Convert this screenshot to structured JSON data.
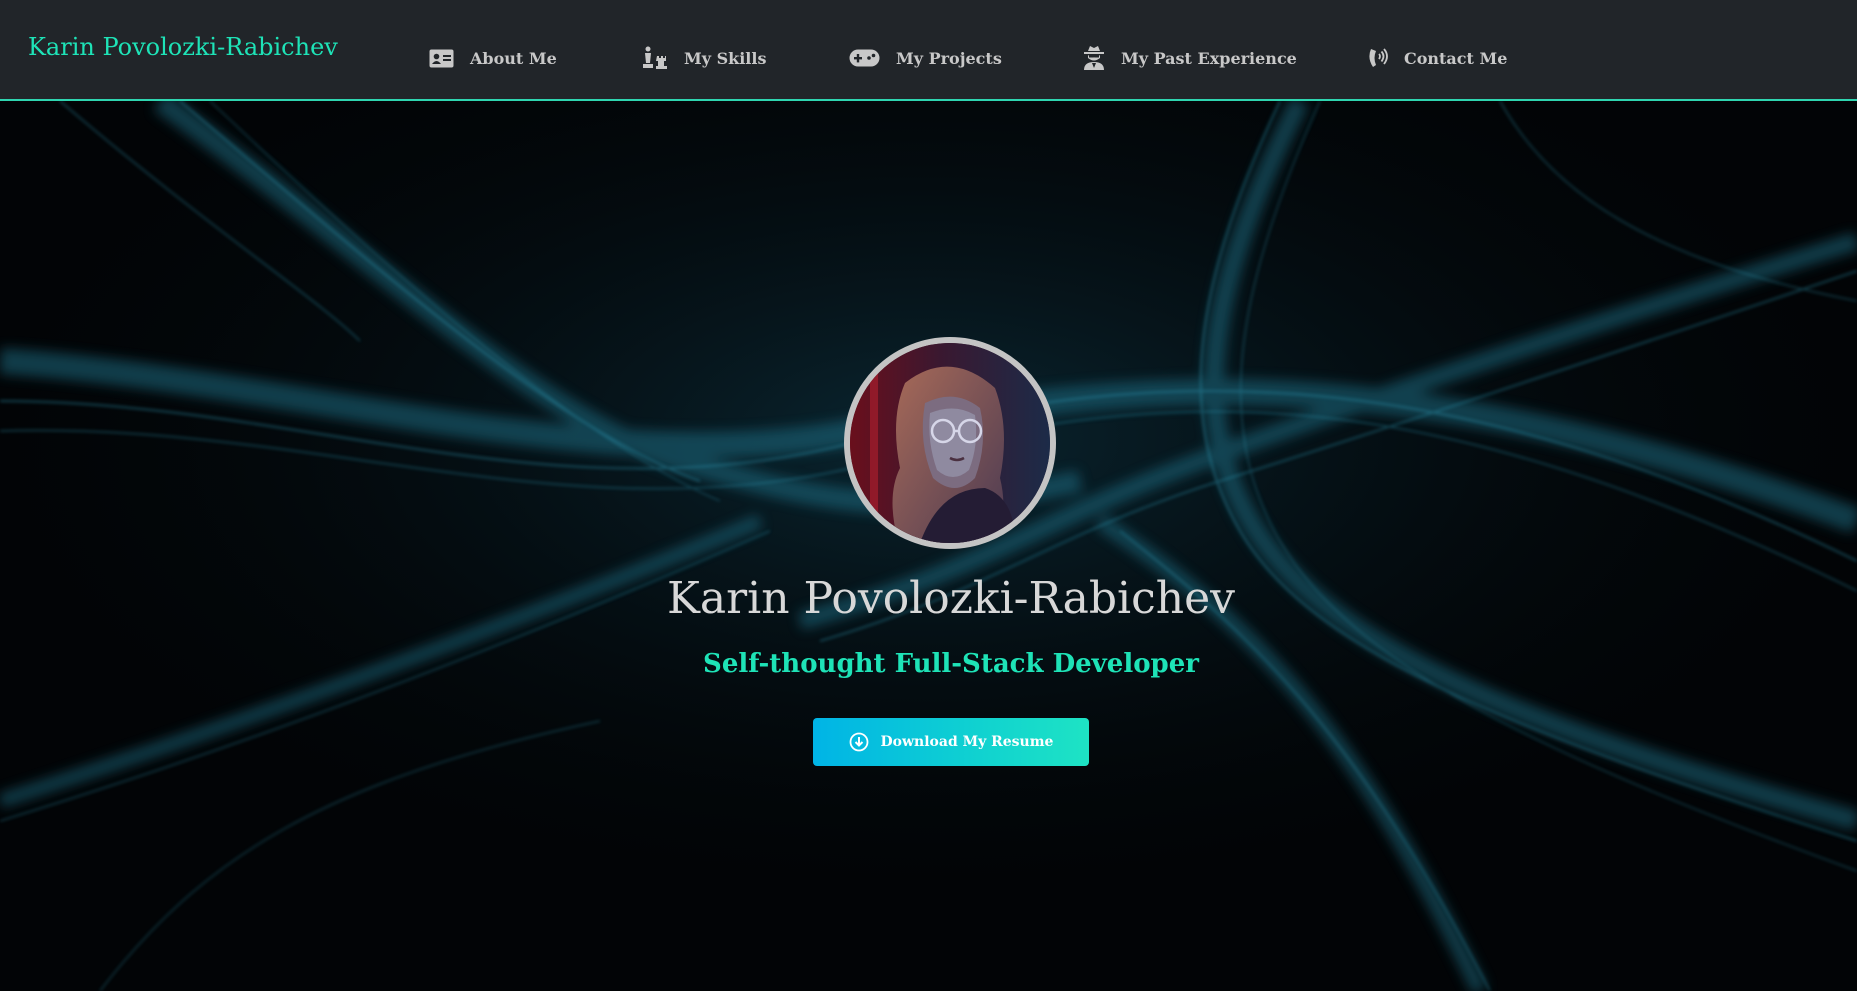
{
  "nav": {
    "brand": "Karin Povolozki-Rabichev",
    "items": [
      {
        "label": "About Me",
        "icon": "id-card-icon"
      },
      {
        "label": "My Skills",
        "icon": "chess-pieces-icon"
      },
      {
        "label": "My Projects",
        "icon": "gamepad-icon"
      },
      {
        "label": "My Past Experience",
        "icon": "user-secret-icon"
      },
      {
        "label": "Contact Me",
        "icon": "phone-volume-icon"
      }
    ]
  },
  "hero": {
    "name": "Karin Povolozki-Rabichev",
    "subtitle": "Self-thought Full-Stack Developer",
    "resume_button": "Download My Resume",
    "resume_icon": "arrow-circle-down-icon"
  },
  "colors": {
    "accent": "#1ee3b7",
    "navbar_bg": "#212529",
    "button_gradient_start": "#00b4e6",
    "button_gradient_end": "#1ee3c4"
  }
}
